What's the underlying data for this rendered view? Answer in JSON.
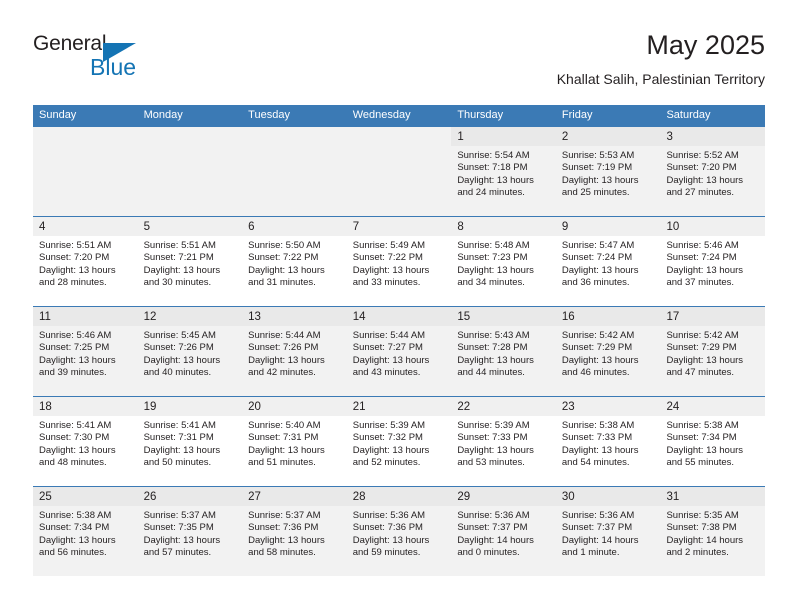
{
  "brand": {
    "word_one": "General",
    "word_two": "Blue",
    "triangle_icon": "triangle-icon",
    "accent_color": "#1474b4"
  },
  "header": {
    "title": "May 2025",
    "subtitle": "Khallat Salih, Palestinian Territory"
  },
  "calendar": {
    "header_color": "#3b7ab5",
    "weekdays": [
      "Sunday",
      "Monday",
      "Tuesday",
      "Wednesday",
      "Thursday",
      "Friday",
      "Saturday"
    ],
    "weeks": [
      [
        {
          "day": "",
          "lines": []
        },
        {
          "day": "",
          "lines": []
        },
        {
          "day": "",
          "lines": []
        },
        {
          "day": "",
          "lines": []
        },
        {
          "day": "1",
          "lines": [
            "Sunrise: 5:54 AM",
            "Sunset: 7:18 PM",
            "Daylight: 13 hours",
            "and 24 minutes."
          ]
        },
        {
          "day": "2",
          "lines": [
            "Sunrise: 5:53 AM",
            "Sunset: 7:19 PM",
            "Daylight: 13 hours",
            "and 25 minutes."
          ]
        },
        {
          "day": "3",
          "lines": [
            "Sunrise: 5:52 AM",
            "Sunset: 7:20 PM",
            "Daylight: 13 hours",
            "and 27 minutes."
          ]
        }
      ],
      [
        {
          "day": "4",
          "lines": [
            "Sunrise: 5:51 AM",
            "Sunset: 7:20 PM",
            "Daylight: 13 hours",
            "and 28 minutes."
          ]
        },
        {
          "day": "5",
          "lines": [
            "Sunrise: 5:51 AM",
            "Sunset: 7:21 PM",
            "Daylight: 13 hours",
            "and 30 minutes."
          ]
        },
        {
          "day": "6",
          "lines": [
            "Sunrise: 5:50 AM",
            "Sunset: 7:22 PM",
            "Daylight: 13 hours",
            "and 31 minutes."
          ]
        },
        {
          "day": "7",
          "lines": [
            "Sunrise: 5:49 AM",
            "Sunset: 7:22 PM",
            "Daylight: 13 hours",
            "and 33 minutes."
          ]
        },
        {
          "day": "8",
          "lines": [
            "Sunrise: 5:48 AM",
            "Sunset: 7:23 PM",
            "Daylight: 13 hours",
            "and 34 minutes."
          ]
        },
        {
          "day": "9",
          "lines": [
            "Sunrise: 5:47 AM",
            "Sunset: 7:24 PM",
            "Daylight: 13 hours",
            "and 36 minutes."
          ]
        },
        {
          "day": "10",
          "lines": [
            "Sunrise: 5:46 AM",
            "Sunset: 7:24 PM",
            "Daylight: 13 hours",
            "and 37 minutes."
          ]
        }
      ],
      [
        {
          "day": "11",
          "lines": [
            "Sunrise: 5:46 AM",
            "Sunset: 7:25 PM",
            "Daylight: 13 hours",
            "and 39 minutes."
          ]
        },
        {
          "day": "12",
          "lines": [
            "Sunrise: 5:45 AM",
            "Sunset: 7:26 PM",
            "Daylight: 13 hours",
            "and 40 minutes."
          ]
        },
        {
          "day": "13",
          "lines": [
            "Sunrise: 5:44 AM",
            "Sunset: 7:26 PM",
            "Daylight: 13 hours",
            "and 42 minutes."
          ]
        },
        {
          "day": "14",
          "lines": [
            "Sunrise: 5:44 AM",
            "Sunset: 7:27 PM",
            "Daylight: 13 hours",
            "and 43 minutes."
          ]
        },
        {
          "day": "15",
          "lines": [
            "Sunrise: 5:43 AM",
            "Sunset: 7:28 PM",
            "Daylight: 13 hours",
            "and 44 minutes."
          ]
        },
        {
          "day": "16",
          "lines": [
            "Sunrise: 5:42 AM",
            "Sunset: 7:29 PM",
            "Daylight: 13 hours",
            "and 46 minutes."
          ]
        },
        {
          "day": "17",
          "lines": [
            "Sunrise: 5:42 AM",
            "Sunset: 7:29 PM",
            "Daylight: 13 hours",
            "and 47 minutes."
          ]
        }
      ],
      [
        {
          "day": "18",
          "lines": [
            "Sunrise: 5:41 AM",
            "Sunset: 7:30 PM",
            "Daylight: 13 hours",
            "and 48 minutes."
          ]
        },
        {
          "day": "19",
          "lines": [
            "Sunrise: 5:41 AM",
            "Sunset: 7:31 PM",
            "Daylight: 13 hours",
            "and 50 minutes."
          ]
        },
        {
          "day": "20",
          "lines": [
            "Sunrise: 5:40 AM",
            "Sunset: 7:31 PM",
            "Daylight: 13 hours",
            "and 51 minutes."
          ]
        },
        {
          "day": "21",
          "lines": [
            "Sunrise: 5:39 AM",
            "Sunset: 7:32 PM",
            "Daylight: 13 hours",
            "and 52 minutes."
          ]
        },
        {
          "day": "22",
          "lines": [
            "Sunrise: 5:39 AM",
            "Sunset: 7:33 PM",
            "Daylight: 13 hours",
            "and 53 minutes."
          ]
        },
        {
          "day": "23",
          "lines": [
            "Sunrise: 5:38 AM",
            "Sunset: 7:33 PM",
            "Daylight: 13 hours",
            "and 54 minutes."
          ]
        },
        {
          "day": "24",
          "lines": [
            "Sunrise: 5:38 AM",
            "Sunset: 7:34 PM",
            "Daylight: 13 hours",
            "and 55 minutes."
          ]
        }
      ],
      [
        {
          "day": "25",
          "lines": [
            "Sunrise: 5:38 AM",
            "Sunset: 7:34 PM",
            "Daylight: 13 hours",
            "and 56 minutes."
          ]
        },
        {
          "day": "26",
          "lines": [
            "Sunrise: 5:37 AM",
            "Sunset: 7:35 PM",
            "Daylight: 13 hours",
            "and 57 minutes."
          ]
        },
        {
          "day": "27",
          "lines": [
            "Sunrise: 5:37 AM",
            "Sunset: 7:36 PM",
            "Daylight: 13 hours",
            "and 58 minutes."
          ]
        },
        {
          "day": "28",
          "lines": [
            "Sunrise: 5:36 AM",
            "Sunset: 7:36 PM",
            "Daylight: 13 hours",
            "and 59 minutes."
          ]
        },
        {
          "day": "29",
          "lines": [
            "Sunrise: 5:36 AM",
            "Sunset: 7:37 PM",
            "Daylight: 14 hours",
            "and 0 minutes."
          ]
        },
        {
          "day": "30",
          "lines": [
            "Sunrise: 5:36 AM",
            "Sunset: 7:37 PM",
            "Daylight: 14 hours",
            "and 1 minute."
          ]
        },
        {
          "day": "31",
          "lines": [
            "Sunrise: 5:35 AM",
            "Sunset: 7:38 PM",
            "Daylight: 14 hours",
            "and 2 minutes."
          ]
        }
      ]
    ]
  }
}
